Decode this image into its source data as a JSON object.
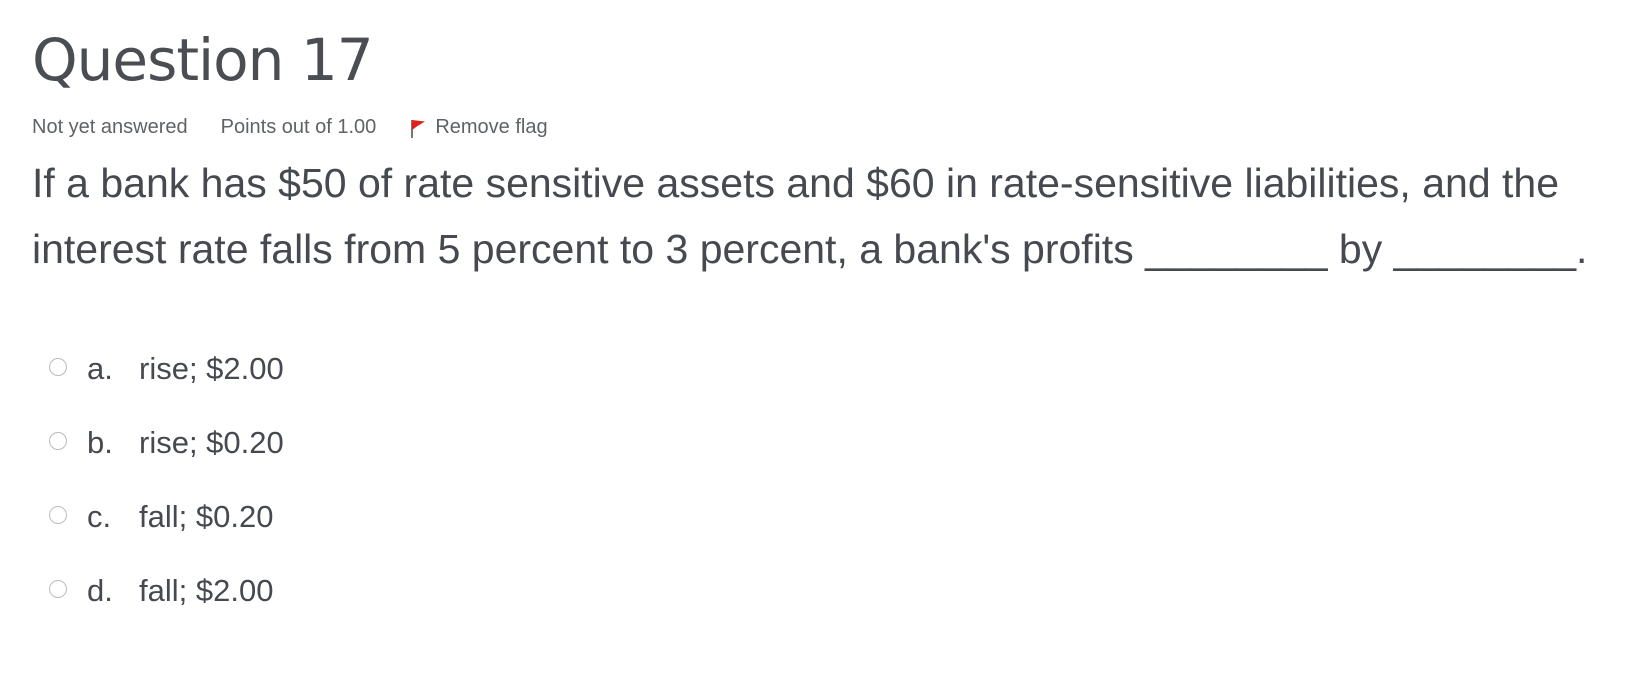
{
  "question": {
    "title": "Question 17",
    "state": "Not yet answered",
    "grade": "Points out of 1.00",
    "flag_label": "Remove flag",
    "text": "If a bank has $50 of rate sensitive assets and $60 in rate-sensitive liabilities, and the interest rate falls from 5 percent to 3 percent, a bank's profits ________ by ________."
  },
  "answers": [
    {
      "letter": "a.",
      "text": "rise; $2.00"
    },
    {
      "letter": "b.",
      "text": "rise; $0.20"
    },
    {
      "letter": "c.",
      "text": "fall; $0.20"
    },
    {
      "letter": "d.",
      "text": "fall; $2.00"
    }
  ],
  "icons": {
    "flag": "flag-icon"
  },
  "colors": {
    "text": "#464a50",
    "muted": "#5f6368",
    "flag_red": "#e0211b",
    "radio_border": "#b8bcc0"
  }
}
